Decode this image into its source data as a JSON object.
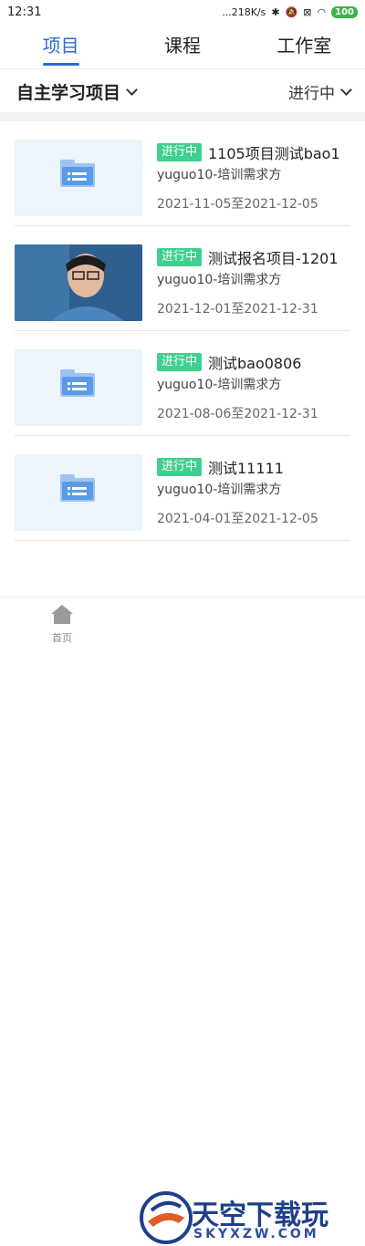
{
  "status_bar": {
    "time": "12:31",
    "speed": "...218K/s",
    "battery": "100"
  },
  "tabs": [
    {
      "label": "项目",
      "active": true
    },
    {
      "label": "课程",
      "active": false
    },
    {
      "label": "工作室",
      "active": false
    }
  ],
  "filter": {
    "left_label": "自主学习项目",
    "right_label": "进行中"
  },
  "items": [
    {
      "status": "进行中",
      "title": "1105项目测试bao1",
      "org": "yuguo10-培训需求方",
      "dates": "2021-11-05至2021-12-05",
      "thumb": "folder"
    },
    {
      "status": "进行中",
      "title": "测试报名项目-1201",
      "org": "yuguo10-培训需求方",
      "dates": "2021-12-01至2021-12-31",
      "thumb": "photo"
    },
    {
      "status": "进行中",
      "title": "测试bao0806",
      "org": "yuguo10-培训需求方",
      "dates": "2021-08-06至2021-12-31",
      "thumb": "folder"
    },
    {
      "status": "进行中",
      "title": "测试11111",
      "org": "yuguo10-培训需求方",
      "dates": "2021-04-01至2021-12-05",
      "thumb": "folder"
    }
  ],
  "bottom_nav": {
    "home_label": "首页"
  },
  "watermark": {
    "text": "天空下载玩",
    "sub": "SKYXZW.COM"
  },
  "colors": {
    "accent": "#2b6bd6",
    "status_tag": "#3fcf8e"
  }
}
